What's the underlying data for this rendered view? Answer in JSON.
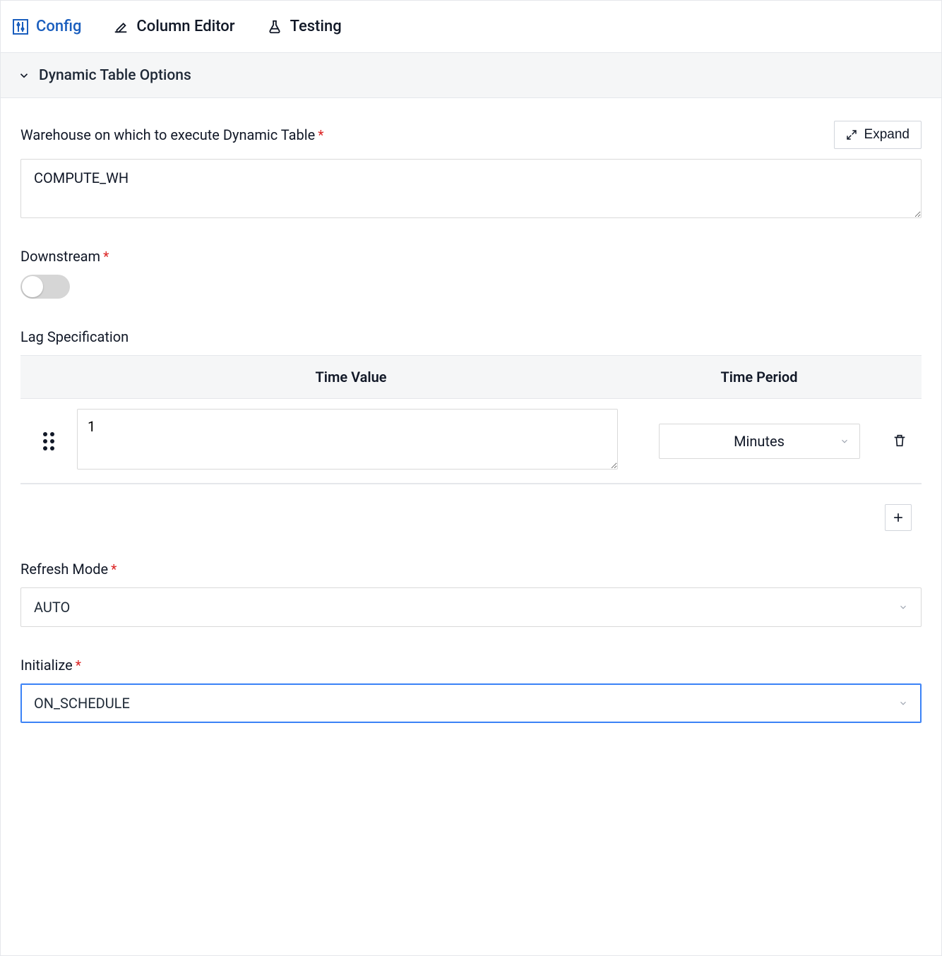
{
  "tabs": {
    "config": "Config",
    "column_editor": "Column Editor",
    "testing": "Testing"
  },
  "section": {
    "title": "Dynamic Table Options"
  },
  "warehouse": {
    "label": "Warehouse on which to execute Dynamic Table",
    "value": "COMPUTE_WH",
    "expand": "Expand"
  },
  "downstream": {
    "label": "Downstream",
    "value": false
  },
  "lag": {
    "label": "Lag Specification",
    "headers": {
      "time_value": "Time Value",
      "time_period": "Time Period"
    },
    "rows": [
      {
        "time_value": "1",
        "time_period": "Minutes"
      }
    ]
  },
  "refresh_mode": {
    "label": "Refresh Mode",
    "value": "AUTO"
  },
  "initialize": {
    "label": "Initialize",
    "value": "ON_SCHEDULE"
  }
}
